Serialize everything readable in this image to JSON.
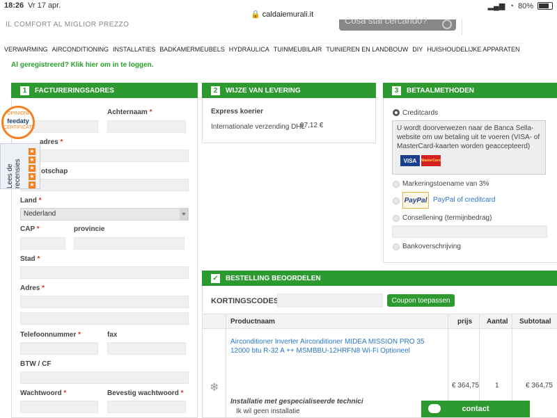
{
  "statusbar": {
    "time": "18:26",
    "date": "Vr 17 apr.",
    "url": "caldaiemurali.it",
    "battery": "80%"
  },
  "header": {
    "tagline": "IL COMFORT AL MIGLIOR PREZZO",
    "search_placeholder": "Cosa stai cercando?"
  },
  "nav": [
    "VERWARMING",
    "AIRCONDITIONING",
    "INSTALLATIES",
    "BADKAMERMEUBELS",
    "HYDRAULICA",
    "TUINMEUBILAIR",
    "TUINIEREN EN LANDBOUW",
    "DIY",
    "HUISHOUDELIJKE APPARATEN"
  ],
  "login_text": "Al geregistreerd? Klik hier om in te loggen.",
  "billing": {
    "num": "1",
    "title": "FACTURERINGSADRES",
    "achternaam": "Achternaam",
    "adres_partial": "adres",
    "bedrijf_partial": "otschap",
    "land": "Land",
    "land_value": "Nederland",
    "cap": "CAP",
    "provincie": "provincie",
    "stad": "Stad",
    "adres": "Adres",
    "telefoon": "Telefoonnummer",
    "fax": "fax",
    "btw": "BTW / CF",
    "wachtwoord": "Wachtwoord",
    "bevestig": "Bevestig wachtwoord"
  },
  "feedaty": {
    "badge_top": "OPINIONI",
    "brand": "feedaty",
    "badge_bottom": "CERTIFICATE",
    "tab": "Lees de recensies"
  },
  "delivery": {
    "num": "2",
    "title": "WIJZE VAN LEVERING",
    "method": "Express koerier",
    "desc": "Internationale verzending DHL",
    "price": "97,12 €"
  },
  "payment": {
    "num": "3",
    "title": "BETAALMETHODEN",
    "creditcards": "Creditcards",
    "creditcards_info": "U wordt doorverwezen naar de Banca Sella-website om uw betaling uit te voeren (VISA- of MasterCard-kaarten worden geaccepteerd)",
    "visa": "VISA",
    "mastercard": "MasterCard",
    "markering": "Markeringstoename van 3%",
    "paypal_logo": "PayPal",
    "paypal_link": "PayPal of creditcard",
    "consellening": "Consellening (termijnbedrag)",
    "bank": "Bankoverschrijving"
  },
  "order": {
    "title": "BESTELLING BEOORDELEN",
    "coupon_label": "KORTINGSCODES",
    "coupon_btn": "Coupon toepassen",
    "columns": {
      "product": "Productnaam",
      "price": "prijs",
      "qty": "Aantal",
      "subtotal": "Subtotaal"
    },
    "item": {
      "name": "Airconditioner Inverter Airconditioner MIDEA MISSION PRO 35 12000 btu R-32 A ++ MSMBBU-12HRFN8 Wi-Fi Optioneel",
      "price": "€ 364,75",
      "qty": "1",
      "subtotal": "€ 364,75",
      "install_title": "Installatie met gespecialiseerde technici",
      "install_option": "Ik wil geen installatie"
    }
  },
  "contact": "contact"
}
